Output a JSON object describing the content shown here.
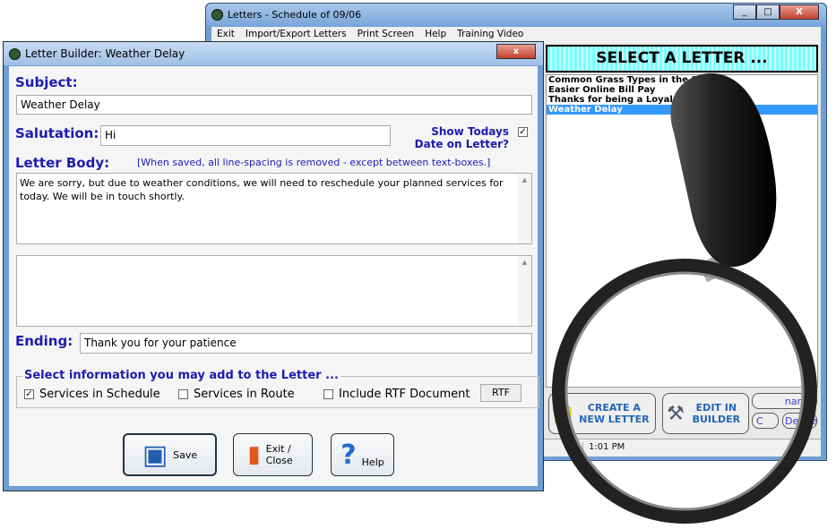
{
  "back_window": {
    "title": "Letters  -  Schedule of 09/06",
    "menu": [
      "Exit",
      "Import/Export Letters",
      "Print Screen",
      "Help",
      "Training Video"
    ],
    "header": "SELECT A LETTER ...",
    "letters": [
      "Common Grass Types in the South",
      "Easier Online Bill Pay",
      "Thanks for being a Loyal Customer",
      "Weather Delay"
    ],
    "selected_letter": "Weather Delay",
    "create_button": "CREATE A NEW LETTER",
    "edit_button": "EDIT IN BUILDER",
    "rename_button": "name",
    "delete_button": "Delete",
    "small_button": "C",
    "status_time": "1:01 PM"
  },
  "dialog": {
    "title": "Letter Builder: Weather Delay",
    "close": "x",
    "subject_label": "Subject:",
    "subject_value": "Weather Delay",
    "salutation_label": "Salutation:",
    "salutation_value": "Hi",
    "show_date_label": "Show Todays Date on Letter?",
    "show_date_checked": true,
    "body_label": "Letter Body:",
    "body_note": "[When saved, all line-spacing is removed - except between text-boxes.]",
    "body_text": "We are sorry, but due to weather conditions, we will need to reschedule your planned services for today. We will be in touch shortly.",
    "body_text2": "",
    "ending_label": "Ending:",
    "ending_value": "Thank you for your patience",
    "group_label": "Select information you may add to the Letter ...",
    "options": [
      {
        "label": "Services in Schedule",
        "checked": true
      },
      {
        "label": "Services in Route",
        "checked": false
      },
      {
        "label": "Include RTF Document",
        "checked": false
      }
    ],
    "rtf_button": "RTF",
    "save": "Save",
    "exit": "Exit / Close",
    "help": "Help"
  },
  "colors": {
    "label_blue": "#1c1cb0",
    "selection": "#3399ff",
    "header_cyan": "#7fffff"
  }
}
